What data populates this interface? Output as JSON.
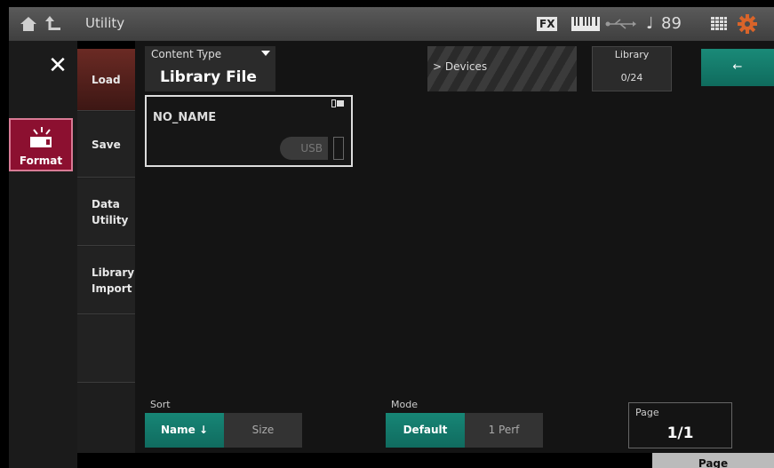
{
  "header": {
    "title": "Utility",
    "fx": "FX",
    "tempo": "89",
    "note_glyph": "♩",
    "icons": [
      "home-icon",
      "up-arrow-icon",
      "keyboard-icon",
      "usb-icon",
      "grid-icon",
      "gear-icon"
    ]
  },
  "sidebar": {
    "close_glyph": "✕",
    "format_label": "Format"
  },
  "tabs": [
    {
      "label": "Load",
      "active": true
    },
    {
      "label": "Save",
      "active": false
    },
    {
      "label": "Data\nUtility",
      "active": false
    },
    {
      "label": "Library\nImport",
      "active": false
    }
  ],
  "content_type": {
    "label": "Content Type",
    "value": "Library File"
  },
  "devices": {
    "label": "> Devices"
  },
  "library": {
    "title": "Library",
    "count": "0/24"
  },
  "back_button": {
    "label": "←"
  },
  "device": {
    "name": "NO_NAME",
    "port": "USB"
  },
  "sort": {
    "label": "Sort",
    "options": [
      "Name ↓",
      "Size"
    ],
    "selected": "Name ↓"
  },
  "mode": {
    "label": "Mode",
    "options": [
      "Default",
      "1 Perf"
    ],
    "selected": "Default"
  },
  "page": {
    "label": "Page",
    "value": "1/1",
    "button": "Page"
  },
  "colors": {
    "accent": "#178676",
    "format_red": "#8c1030",
    "tab_active": "#6b2a24"
  }
}
